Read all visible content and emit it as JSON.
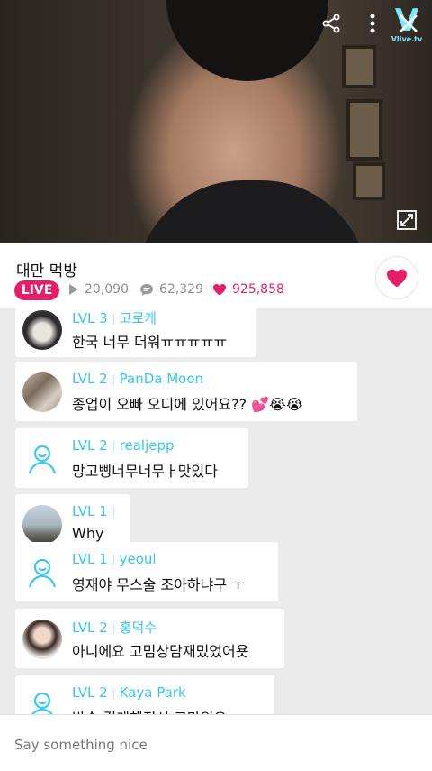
{
  "brand": {
    "logo_text": "V",
    "logo_sub": "Vlive.tv"
  },
  "broadcast": {
    "title": "대만 먹방",
    "live_label": "LIVE",
    "views": "20,090",
    "comments": "62,329",
    "hearts": "925,858"
  },
  "chat": [
    {
      "level": "LVL 3",
      "user": "고로케",
      "message": "한국 너무 더워ㅠㅠㅠㅠㅠ",
      "avatar": "photo"
    },
    {
      "level": "LVL 2",
      "user": "PanDa Moon",
      "message": "종업이 오빠 오디에 있어요?? 💕😭😭",
      "avatar": "photo"
    },
    {
      "level": "LVL 2",
      "user": "realjepp",
      "message": "망고삥너무너무ㅏ맛있다",
      "avatar": "default"
    },
    {
      "level": "LVL 1",
      "user": "",
      "message": "Why",
      "avatar": "photo"
    },
    {
      "level": "LVL 1",
      "user": "yeoul",
      "message": "영재야 무스술 조아하냐구 ㅜ",
      "avatar": "default"
    },
    {
      "level": "LVL 2",
      "user": "홍덕수",
      "message": "아니에요 고밈상담재밌었어욧",
      "avatar": "photo"
    },
    {
      "level": "LVL 2",
      "user": "Kaya Park",
      "message": "방송 길게해줘서 고마워요",
      "avatar": "default"
    }
  ],
  "input": {
    "placeholder": "Say something nice"
  },
  "colors": {
    "accent": "#e51e6a",
    "level_blue": "#36c6ee",
    "chat_bg": "#ebebeb"
  }
}
